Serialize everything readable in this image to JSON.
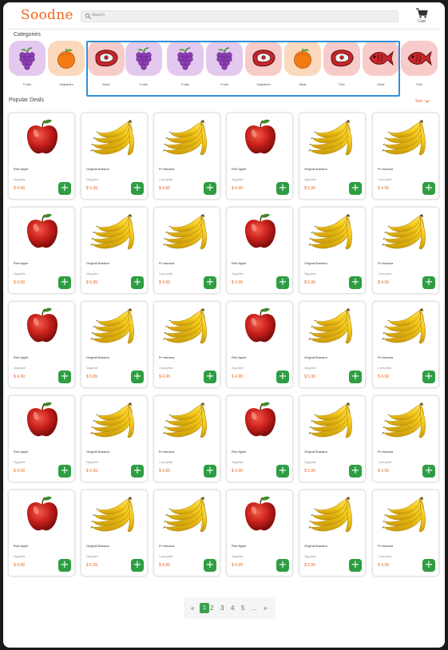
{
  "app": {
    "logo": "Soodne",
    "brand_color": "#e8691f"
  },
  "search": {
    "placeholder": "Search"
  },
  "cart": {
    "label": "Cart"
  },
  "categories": {
    "title": "Categories",
    "items": [
      {
        "label": "Fruits",
        "icon": "grapes-icon"
      },
      {
        "label": "Vegtables",
        "icon": "orange-icon"
      },
      {
        "label": "Meat",
        "icon": "meat-icon"
      },
      {
        "label": "Fruits",
        "icon": "grapes-icon"
      },
      {
        "label": "Fruits",
        "icon": "grapes-icon"
      },
      {
        "label": "Fruits",
        "icon": "grapes-icon"
      },
      {
        "label": "Vegtables",
        "icon": "meat-icon"
      },
      {
        "label": "Meat",
        "icon": "orange-icon"
      },
      {
        "label": "Fish",
        "icon": "meat-icon"
      },
      {
        "label": "Meat",
        "icon": "fish-icon"
      },
      {
        "label": "Fish",
        "icon": "fish-icon"
      }
    ]
  },
  "deals": {
    "title": "Popular Deals",
    "sort_label": "Sort",
    "products": [
      {
        "name": "Red Apple",
        "qty": "1kg,price",
        "price": "$ 4,99",
        "image": "apple"
      },
      {
        "name": "Original Banana",
        "qty": "1kg,price",
        "price": "$ 5,99",
        "image": "banana"
      },
      {
        "name": "Pv banana",
        "qty": "1 pcs,price",
        "price": "$ 4,99",
        "image": "banana"
      },
      {
        "name": "Red Apple",
        "qty": "1kg,price",
        "price": "$ 4,99",
        "image": "apple"
      },
      {
        "name": "Original Banana",
        "qty": "1kg,price",
        "price": "$ 5,99",
        "image": "banana"
      },
      {
        "name": "Pv banana",
        "qty": "1 pcs,price",
        "price": "$ 4,99",
        "image": "banana"
      }
    ],
    "add_label": "+"
  },
  "pagination": {
    "prev": "«",
    "pages": [
      "1",
      "2",
      "3",
      "4",
      "5",
      "..."
    ],
    "next": "»",
    "current": "1"
  }
}
